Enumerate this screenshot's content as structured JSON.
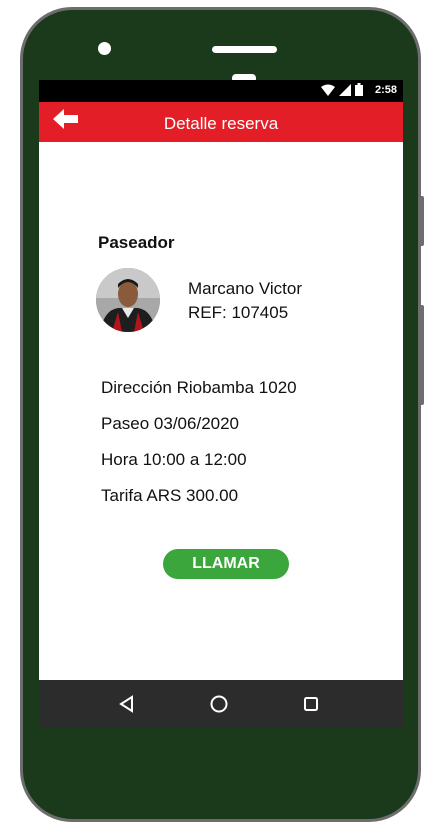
{
  "status_bar": {
    "time": "2:58"
  },
  "app_bar": {
    "title": "Detalle reserva"
  },
  "walker": {
    "section_title": "Paseador",
    "name": "Marcano Victor",
    "ref": "REF: 107405"
  },
  "details": {
    "direccion": "Dirección Riobamba 1020",
    "paseo": "Paseo 03/06/2020",
    "hora": "Hora 10:00 a 12:00",
    "tarifa": "Tarifa ARS 300.00"
  },
  "actions": {
    "call_label": "LLAMAR"
  },
  "colors": {
    "app_bar": "#e41e26",
    "call_button": "#3aa63b",
    "phone_body": "#1b3a1c",
    "nav_bar": "#2c2c2c"
  },
  "icons": {
    "back": "arrow-left-icon",
    "nav_back": "triangle-back-icon",
    "nav_home": "circle-home-icon",
    "nav_recents": "square-recents-icon",
    "wifi": "wifi-icon",
    "signal": "signal-icon",
    "battery": "battery-icon"
  }
}
